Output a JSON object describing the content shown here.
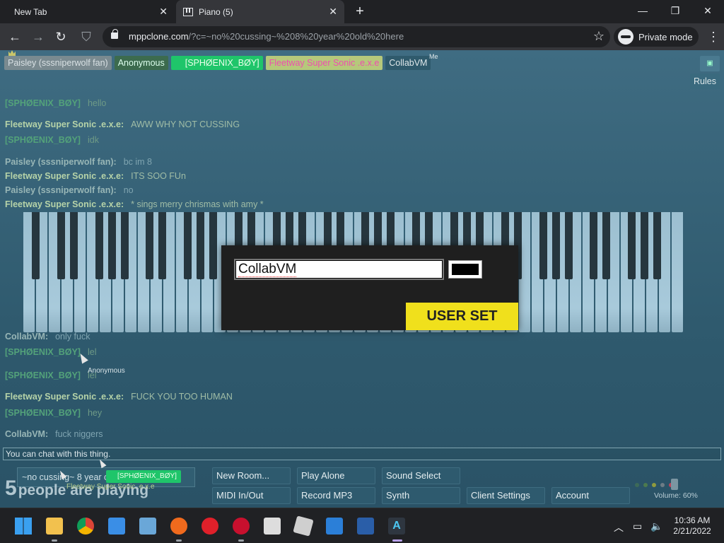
{
  "browser": {
    "tabs": [
      {
        "label": "New Tab"
      },
      {
        "label": "Piano (5)"
      }
    ],
    "url_host": "mppclone.com",
    "url_rest": "/?c=~no%20cussing~%208%20year%20old%20here",
    "private_label": "Private mode"
  },
  "room": {
    "names": [
      {
        "label": "Paisley (sssniperwolf fan)",
        "kind": "paisley"
      },
      {
        "label": "Anonymous",
        "kind": "anon"
      },
      {
        "label": "[SPHØENIX_BØY]",
        "kind": "phoenix"
      },
      {
        "label": "Fleetway Super Sonic .e.x.e",
        "kind": "fleetway"
      },
      {
        "label": "CollabVM",
        "kind": "collab"
      }
    ],
    "me_label": "Me",
    "rules_label": "Rules"
  },
  "chat": {
    "messages": [
      {
        "who": "[SPHØENIX_BØY]",
        "text": "hello",
        "style": "green"
      },
      {
        "who": "Fleetway Super Sonic .e.x.e:",
        "text": "AWW WHY NOT CUSSING",
        "style": "bright"
      },
      {
        "who": "[SPHØENIX_BØY]",
        "text": "idk",
        "style": "green"
      },
      {
        "who": "Paisley (sssniperwolf fan):",
        "text": "bc im 8",
        "style": "dim"
      },
      {
        "who": "Fleetway Super Sonic .e.x.e:",
        "text": "ITS SOO FUn",
        "style": "bright"
      },
      {
        "who": "Paisley (sssniperwolf fan):",
        "text": "no",
        "style": "dim"
      },
      {
        "who": "Fleetway Super Sonic .e.x.e:",
        "text": "* sings merry chrismas with amy *",
        "style": "bright"
      },
      {
        "who": "CollabVM:",
        "text": "only fuck",
        "style": "dim"
      },
      {
        "who": "[SPHØENIX_BØY]",
        "text": "lel",
        "style": "green"
      },
      {
        "who": "[SPHØENIX_BØY]",
        "text": "lel",
        "style": "green"
      },
      {
        "who": "Fleetway Super Sonic .e.x.e:",
        "text": "FUCK YOU TOO HUMAN",
        "style": "bright"
      },
      {
        "who": "[SPHØENIX_BØY]",
        "text": "hey",
        "style": "green"
      },
      {
        "who": "CollabVM:",
        "text": "fuck niggers",
        "style": "dim"
      }
    ],
    "input_placeholder": "You can chat with this thing."
  },
  "modal": {
    "name_value": "CollabVM",
    "color": "#000000",
    "button_label": "USER SET"
  },
  "bottom": {
    "room_name": "~no cussing~ 8 year old here",
    "people_count": "5",
    "people_text": "people are playing",
    "buttons": [
      {
        "label": "New Room..."
      },
      {
        "label": "Play Alone"
      },
      {
        "label": "Sound Select"
      },
      {
        "label": "MIDI In/Out"
      },
      {
        "label": "Record MP3"
      },
      {
        "label": "Synth"
      },
      {
        "label": "Client Settings"
      },
      {
        "label": "Account"
      }
    ],
    "volume_label": "Volume: 60%",
    "cursor_label": "Anonymous",
    "cursor_tag_phoenix": "[SPHØENIX_BØY]",
    "cursor_tag_fleetway": "Fleetway Super Sonic .e.x.e"
  },
  "taskbar": {
    "time": "10:36 AM",
    "date": "2/21/2022"
  },
  "colors": {
    "accent_yellow": "#f0e01c",
    "phoenix_green": "#1fc56a",
    "page_bg": "#2f5a6e"
  }
}
